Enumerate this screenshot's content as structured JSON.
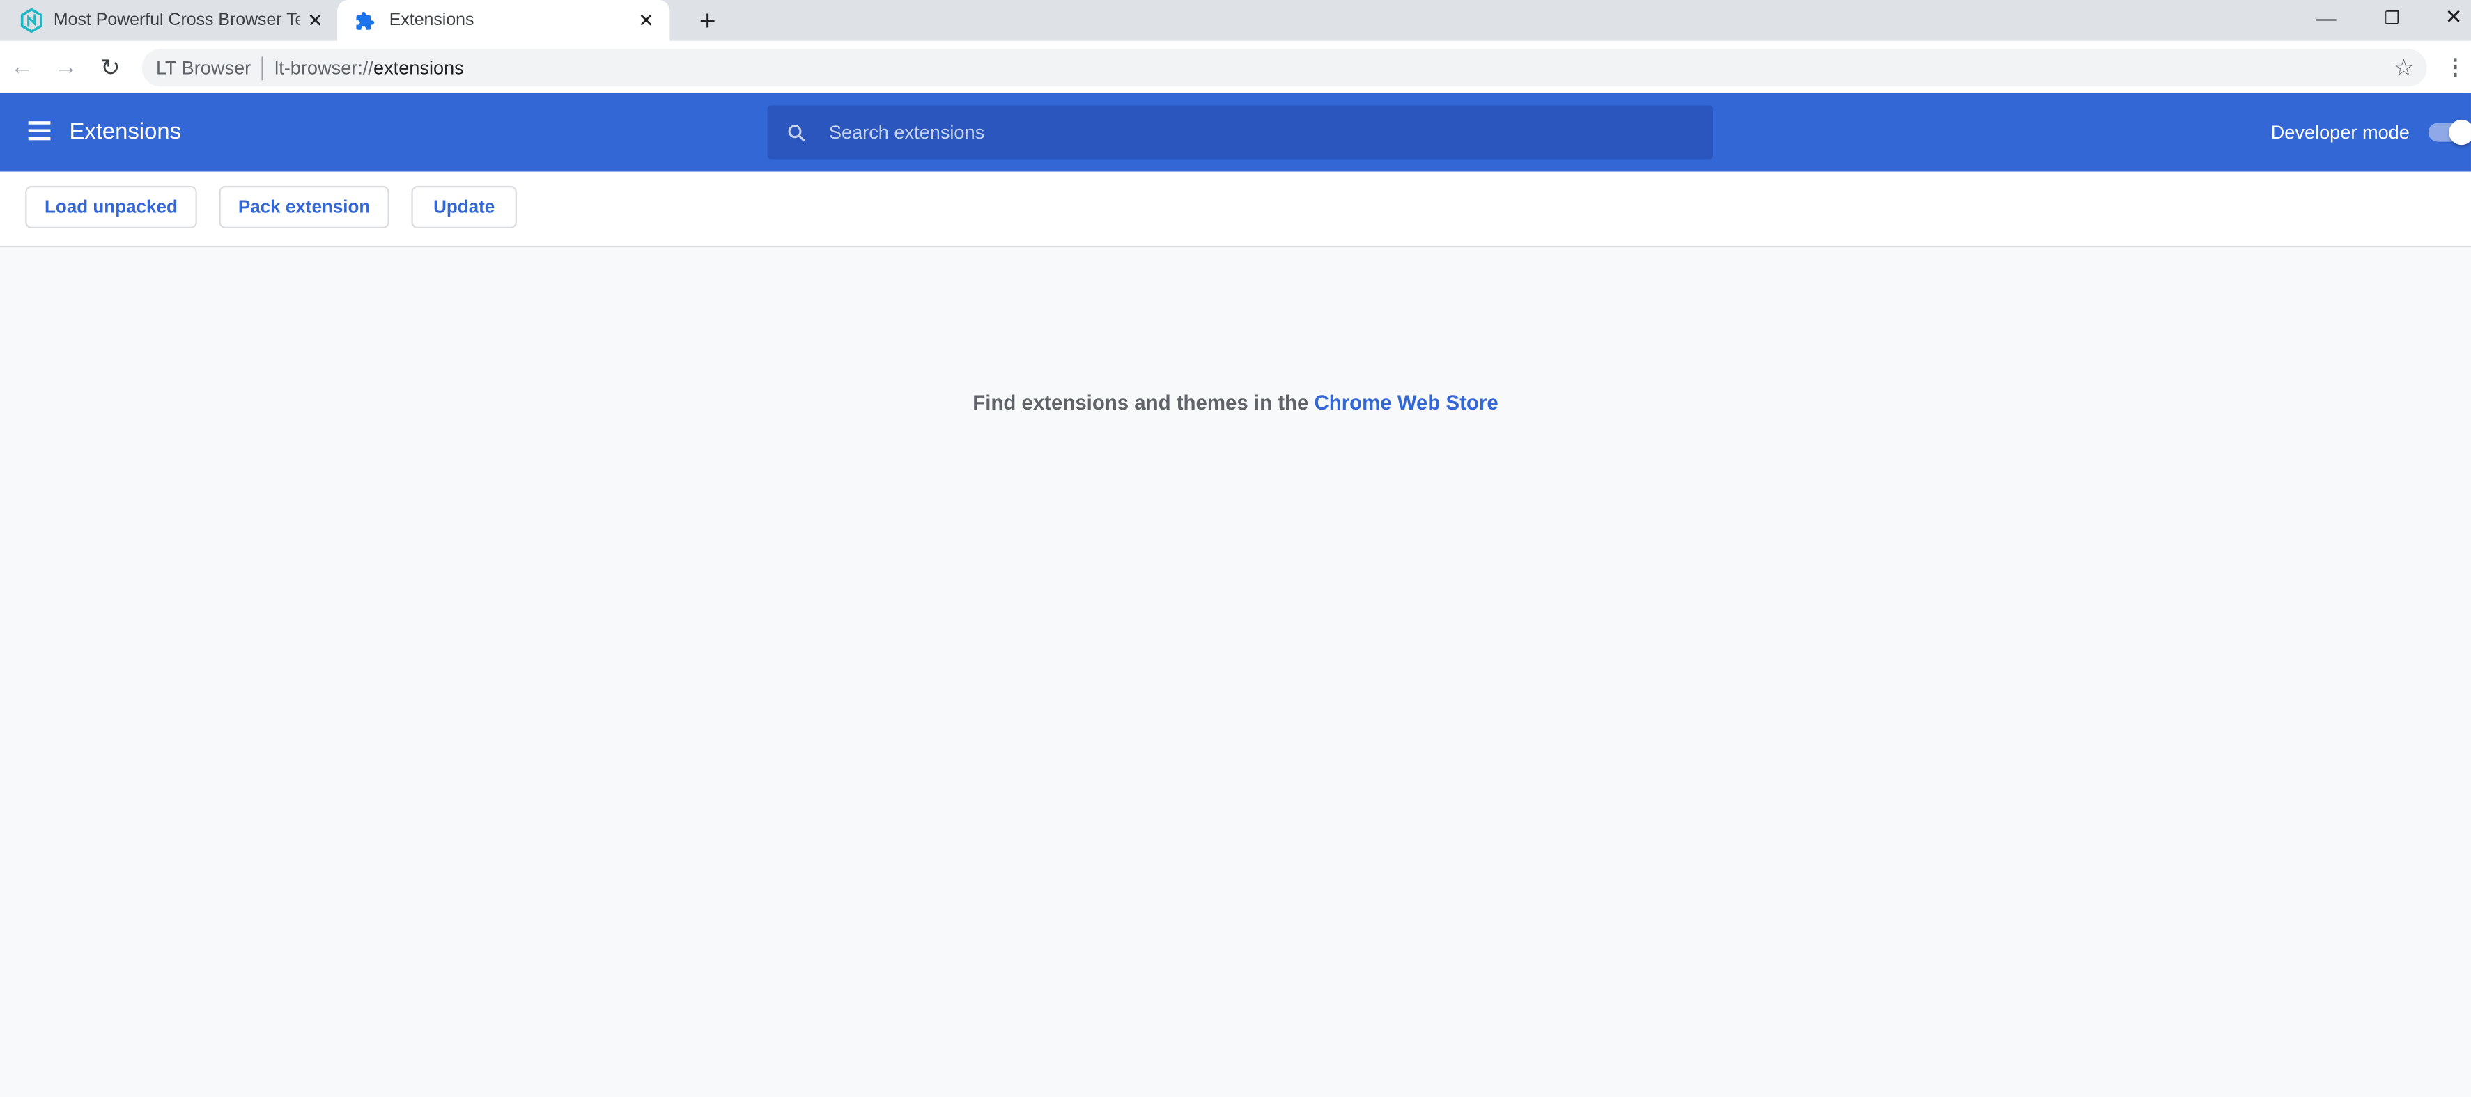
{
  "browser": {
    "tabs": [
      {
        "title": "Most Powerful Cross Browser Tes",
        "icon": "lambdatest-logo-icon",
        "active": false
      },
      {
        "title": "Extensions",
        "icon": "puzzle-icon",
        "active": true
      }
    ],
    "new_tab_label": "+",
    "omnibox": {
      "site_label": "LT Browser",
      "url_prefix": "lt-browser://",
      "url_path": "extensions"
    }
  },
  "header": {
    "title": "Extensions",
    "search_placeholder": "Search extensions",
    "developer_mode_label": "Developer mode",
    "developer_mode_on": true
  },
  "toolbar": {
    "load_unpacked": "Load unpacked",
    "pack_extension": "Pack extension",
    "update": "Update"
  },
  "main": {
    "empty_text": "Find extensions and themes in the",
    "store_link": "Chrome Web Store"
  },
  "colors": {
    "accent": "#3367d6",
    "tabbar": "#dee1e6",
    "body": "#f8f9fa"
  }
}
